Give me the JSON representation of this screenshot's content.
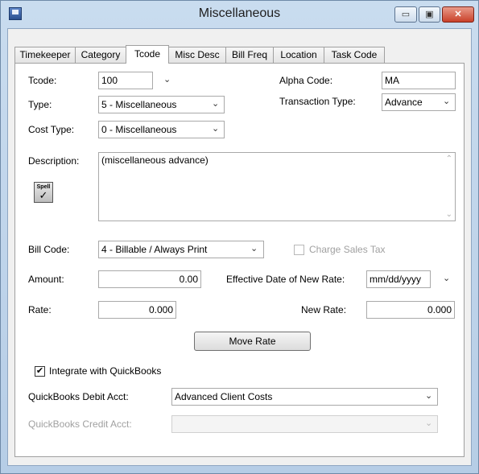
{
  "window": {
    "title": "Miscellaneous",
    "min_glyph": "▭",
    "max_glyph": "▣",
    "close_glyph": "✕"
  },
  "tabs": [
    {
      "label": "Timekeeper"
    },
    {
      "label": "Category"
    },
    {
      "label": "Tcode",
      "active": true
    },
    {
      "label": "Misc Desc"
    },
    {
      "label": "Bill Freq"
    },
    {
      "label": "Location"
    },
    {
      "label": "Task Code"
    }
  ],
  "form": {
    "tcode": {
      "label": "Tcode:",
      "value": "100"
    },
    "alpha_code": {
      "label": "Alpha Code:",
      "value": "MA"
    },
    "type": {
      "label": "Type:",
      "value": "5 - Miscellaneous"
    },
    "transaction_type": {
      "label": "Transaction Type:",
      "value": "Advance"
    },
    "cost_type": {
      "label": "Cost Type:",
      "value": "0 - Miscellaneous"
    },
    "description": {
      "label": "Description:",
      "value": "(miscellaneous advance)"
    },
    "spell": {
      "top": "Spell",
      "mark": "✓"
    },
    "bill_code": {
      "label": "Bill Code:",
      "value": "4 - Billable / Always Print"
    },
    "charge_sales_tax": {
      "label": "Charge Sales Tax",
      "checked": false,
      "enabled": false
    },
    "amount": {
      "label": "Amount:",
      "value": "0.00"
    },
    "effective_date": {
      "label": "Effective Date of New Rate:",
      "value": "mm/dd/yyyy"
    },
    "rate": {
      "label": "Rate:",
      "value": "0.000"
    },
    "new_rate": {
      "label": "New Rate:",
      "value": "0.000"
    },
    "move_rate_button": "Move Rate",
    "integrate_qb": {
      "label": "Integrate with QuickBooks",
      "checked": true,
      "mark": "✔"
    },
    "qb_debit": {
      "label": "QuickBooks Debit Acct:",
      "value": "Advanced Client Costs"
    },
    "qb_credit": {
      "label": "QuickBooks Credit Acct:",
      "value": ""
    }
  },
  "icons": {
    "dropdown": "chevron-down-icon",
    "scroll_up": "scroll-up-arrow-icon",
    "scroll_down": "scroll-down-arrow-icon"
  }
}
